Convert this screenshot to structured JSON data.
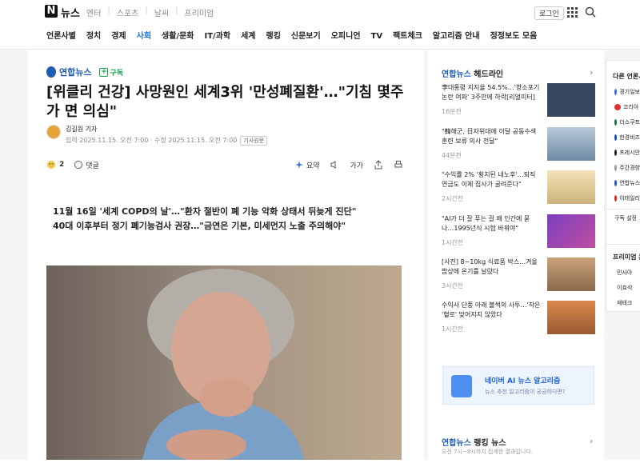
{
  "header": {
    "logo": "N",
    "service": "뉴스",
    "nav": [
      "엔터",
      "스포츠",
      "날씨",
      "프리미엄"
    ],
    "login": "로그인"
  },
  "categories": [
    "언론사별",
    "정치",
    "경제",
    "사회",
    "생활/문화",
    "IT/과학",
    "세계",
    "랭킹",
    "신문보기",
    "오피니언",
    "TV",
    "팩트체크",
    "알고리즘 안내",
    "정정보도 모음"
  ],
  "active_category": "사회",
  "article": {
    "press": "연합뉴스",
    "subscribe": "구독",
    "title": "[위클리 건강] 사망원인 세계3위 '만성폐질환'…\"기침 몇주가 면 의심\"",
    "reporter": "김길원 기자",
    "dates": "입력 2025.11.15. 오전 7:00 · 수정 2025.11.15. 오전 7:00",
    "original": "기사원문",
    "reactions": "2",
    "comments": "댓글",
    "summary_btn": "요약",
    "font_btn": "가가",
    "summary": [
      "11월 16일 '세계 COPD의 날'…\"환자 절반이 폐 기능 악화 상태서 뒤늦게 진단\"",
      "40대 이후부터 정기 폐기능검사 권장…\"금연은 기본, 미세먼지 노출 주의해야\""
    ]
  },
  "headlines": {
    "press": "연합뉴스",
    "label": "헤드라인",
    "items": [
      {
        "title": "李대통령 지지율 54.5%…'항소포기 논란 여파' 3주만에 하락[리얼미터]",
        "ago": "16분전"
      },
      {
        "title": "\"韓해군, 日자위대에 이달 공동수색 훈련 보류 의사 전달\"",
        "ago": "44분전"
      },
      {
        "title": "\"수익률 2% '횡치된 내노후'…퇴직연금도 이제 집사가 굴려준다\"",
        "ago": "2시간전"
      },
      {
        "title": "\"AI가 더 잘 푸는 걸 왜 인간에 묻나…1995년식 시험 바꿔야\"",
        "ago": "1시간전"
      },
      {
        "title": "[사진] 8~10kg 식료품 박스…겨울밥상에 온기를 날랐다",
        "ago": "3시간전"
      },
      {
        "title": "수익사 단풍 아래 볼썩의 사투…'작은 '혈로' 맞어지지 않았다",
        "ago": "1시간전"
      }
    ]
  },
  "ai_box": {
    "title": "네이버 AI 뉴스 알고리즘",
    "sub": "뉴스 추천 알고리즘이 궁금하다면?"
  },
  "ranking": {
    "press": "연합뉴스",
    "label": "랭킹 뉴스",
    "sub": "오전 7시~8시까지 집계한 결과입니다."
  },
  "side_panel": {
    "title": "다른 언론사",
    "presses": [
      "경기일보",
      "코리아",
      "더스쿠프",
      "한경비즈",
      "프레시안",
      "주간경향",
      "연합뉴스",
      "이데일리"
    ],
    "settings": "구독 설정",
    "premium_title": "프리미엄 콘텐츠",
    "premium": [
      "민사아",
      "이효석",
      "재테크"
    ]
  },
  "colors": {
    "accent": "#1a73e8",
    "press_blue": "#1e5cb3",
    "subscribe_green": "#12a34a"
  }
}
